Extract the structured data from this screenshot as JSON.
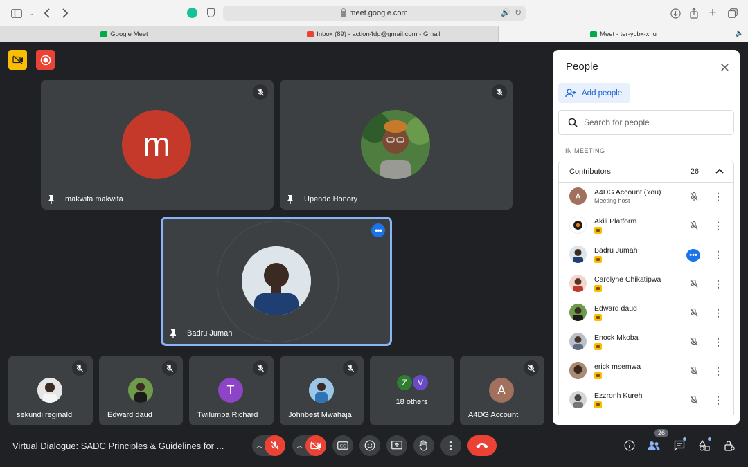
{
  "browser": {
    "url": "meet.google.com",
    "tabs": [
      {
        "label": "Google Meet",
        "active": false
      },
      {
        "label": "Inbox (89) - action4dg@gmail.com - Gmail",
        "active": false
      },
      {
        "label": "Meet - ter-ycbx-xnu",
        "active": true
      }
    ]
  },
  "meeting": {
    "title": "Virtual Dialogue: SADC Principles & Guidelines for ...",
    "participant_count": "26"
  },
  "tiles": [
    {
      "name": "makwita makwita",
      "initial": "m",
      "avatar_color": "#c5392a"
    },
    {
      "name": "Upendo Honory"
    },
    {
      "name": "Badru Jumah"
    }
  ],
  "strip": [
    {
      "name": "sekundi reginald"
    },
    {
      "name": "Edward daud"
    },
    {
      "name": "Twilumba Richard",
      "initial": "T",
      "avatar_color": "#8e44c6"
    },
    {
      "name": "Johnbest Mwahaja"
    },
    {
      "name": "18 others",
      "initials": [
        "Z",
        "V"
      ]
    },
    {
      "name": "A4DG Account",
      "initial": "A",
      "avatar_color": "#a1715d"
    }
  ],
  "panel": {
    "title": "People",
    "add_people": "Add people",
    "search_placeholder": "Search for people",
    "section": "IN MEETING",
    "group_label": "Contributors",
    "group_count": "26",
    "people": [
      {
        "name": "A4DG Account (You)",
        "sub": "Meeting host",
        "initial": "A",
        "avatar_color": "#a1715d"
      },
      {
        "name": "Akili Platform"
      },
      {
        "name": "Badru Jumah",
        "speaking": true
      },
      {
        "name": "Carolyne Chikatipwa"
      },
      {
        "name": "Edward daud"
      },
      {
        "name": "Enock Mkoba"
      },
      {
        "name": "erick msemwa"
      },
      {
        "name": "Ezzronh Kureh"
      }
    ]
  },
  "colors": {
    "accent": "#1a73e8",
    "danger": "#ea4335",
    "tile_bg": "#3c4043",
    "active_border": "#8ab4f8"
  }
}
